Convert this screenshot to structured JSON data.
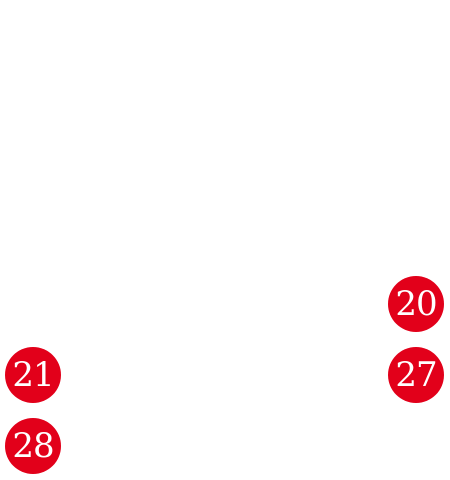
{
  "accent_color": "#e2001a",
  "calendar": {
    "days": {
      "d20": "20",
      "d21": "21",
      "d27": "27",
      "d28": "28"
    }
  }
}
